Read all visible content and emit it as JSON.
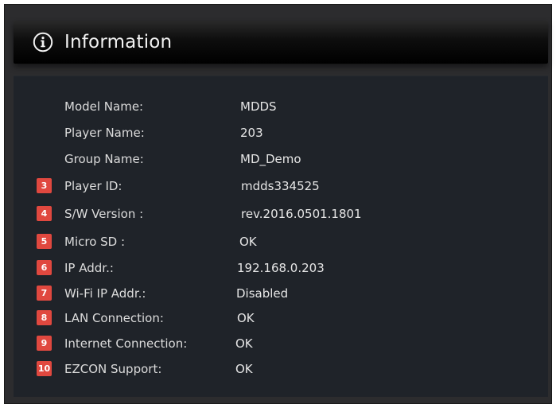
{
  "header": {
    "icon": "info-circle-icon",
    "title": "Information"
  },
  "badge_color": "#e0483f",
  "rows": [
    {
      "badge": "",
      "label": "Model Name:",
      "value": "MDDS"
    },
    {
      "badge": "",
      "label": "Player Name:",
      "value": "203"
    },
    {
      "badge": "",
      "label": "Group Name:",
      "value": "MD_Demo"
    },
    {
      "badge": "3",
      "label": "Player ID:",
      "value": "mdds334525"
    },
    {
      "badge": "4",
      "label": "S/W Version :",
      "value": "rev.2016.0501.1801"
    },
    {
      "badge": "5",
      "label": "Micro SD :",
      "value": "OK"
    },
    {
      "badge": "6",
      "label": "IP Addr.:",
      "value": "192.168.0.203"
    },
    {
      "badge": "7",
      "label": "Wi-Fi IP Addr.:",
      "value": "Disabled"
    },
    {
      "badge": "8",
      "label": "LAN Connection:",
      "value": "OK"
    },
    {
      "badge": "9",
      "label": "Internet Connection:",
      "value": "OK"
    },
    {
      "badge": "10",
      "label": "EZCON Support:",
      "value": "OK"
    }
  ]
}
